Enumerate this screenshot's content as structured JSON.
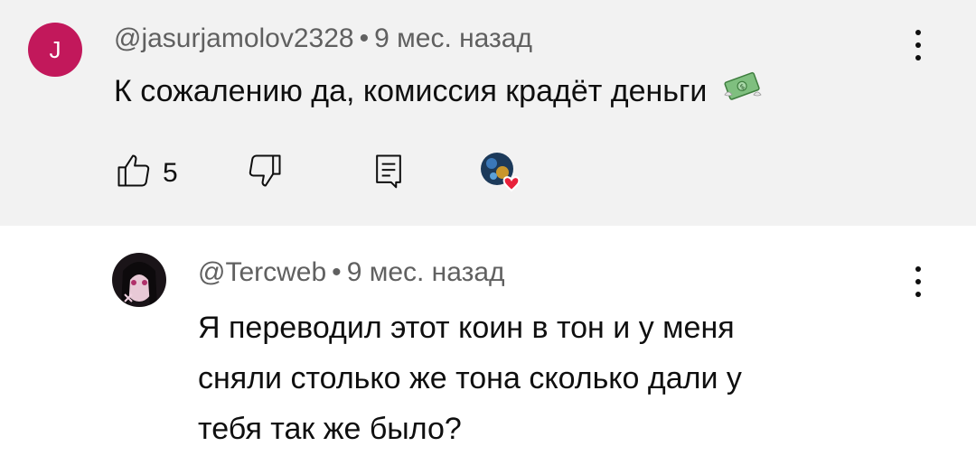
{
  "comment": {
    "avatar_letter": "J",
    "avatar_color": "#c2185b",
    "author": "@jasurjamolov2328",
    "separator": "•",
    "time": "9 мес. назад",
    "text": "К сожалению да, комиссия крадёт деньги",
    "emoji": "money-with-wings-icon",
    "like_count": "5",
    "heart_color": "#e8213a"
  },
  "reply": {
    "author": "@Tercweb",
    "separator": "•",
    "time": "9 мес. назад",
    "text_lines": [
      "Я переводил этот коин в тон и у меня",
      "сняли столько же тона сколько дали у",
      "тебя так же было?"
    ]
  }
}
